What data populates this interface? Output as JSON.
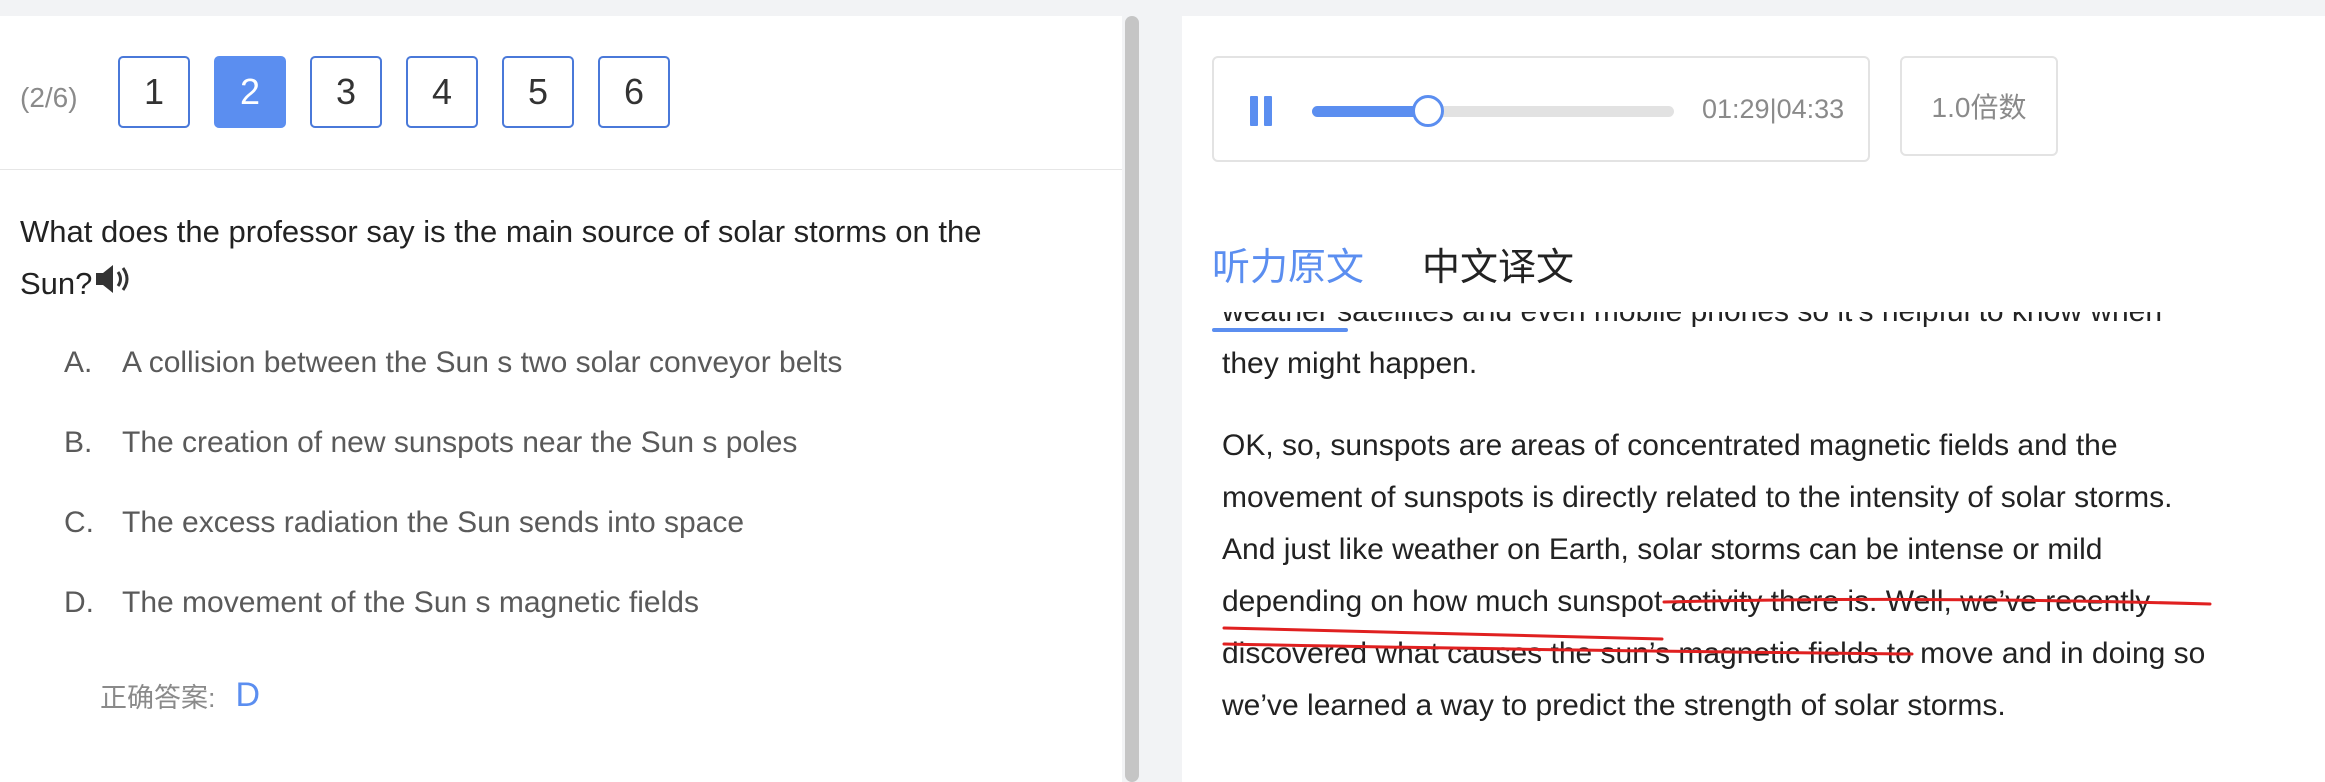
{
  "nav": {
    "progress": "(2/6)",
    "questions": [
      "1",
      "2",
      "3",
      "4",
      "5",
      "6"
    ],
    "active_index": 1
  },
  "question": {
    "text": "What does the professor say is the main source of solar storms on the Sun?",
    "speaker_icon": "speaker-icon",
    "options": [
      {
        "letter": "A.",
        "text": "A collision between the Sun s two solar conveyor belts"
      },
      {
        "letter": "B.",
        "text": "The creation of new sunspots near the Sun s poles"
      },
      {
        "letter": "C.",
        "text": "The excess radiation the Sun sends into space"
      },
      {
        "letter": "D.",
        "text": "The movement of the Sun s magnetic fields"
      }
    ],
    "answer_label": "正确答案:",
    "answer_value": "D"
  },
  "player": {
    "state_icon": "pause-icon",
    "progress_fraction": 0.32,
    "time": "01:29|04:33",
    "speed_label": "1.0倍数"
  },
  "tabs": {
    "original": "听力原文",
    "translation": "中文译文",
    "active": "original"
  },
  "transcript": {
    "cut_line": "weather satellites and even mobile phones so it’s helpful to know when",
    "p1_end": "they might happen.",
    "p2_lines": [
      "OK, so, sunspots are areas of concentrated magnetic fields and the",
      "movement of sunspots is directly related to the intensity of solar storms.",
      "And just like weather on Earth, solar storms can be intense or mild",
      "depending on how much sunspot activity there is. Well, we’ve recently",
      "discovered what causes the sun’s magnetic fields to move and in doing so",
      "we’ve learned a way to predict the strength of solar storms."
    ]
  },
  "colors": {
    "accent": "#5b8ef0",
    "annotation": "#e02020"
  }
}
